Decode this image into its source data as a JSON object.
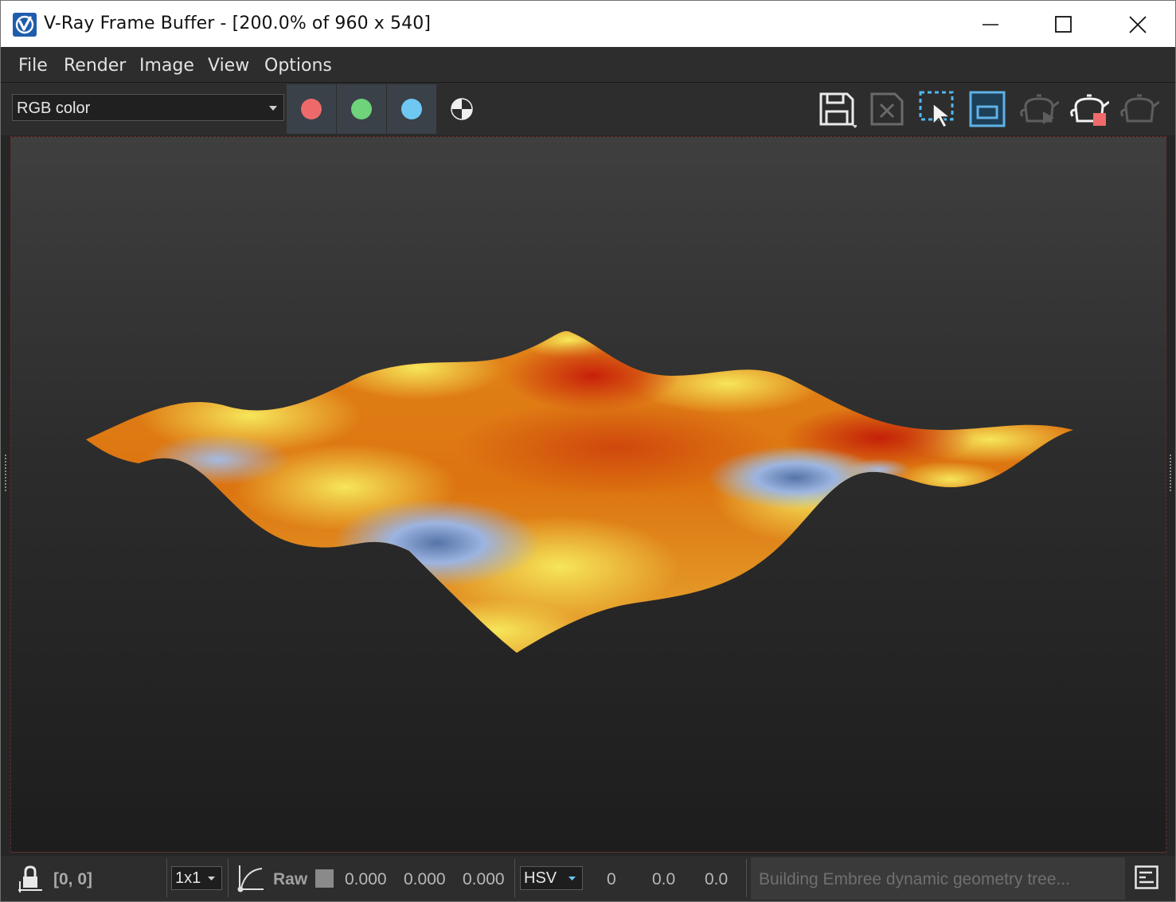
{
  "window": {
    "title": "V-Ray Frame Buffer - [200.0% of 960 x 540]",
    "controls": [
      "minimize",
      "maximize",
      "close"
    ]
  },
  "menu": {
    "items": [
      "File",
      "Render",
      "Image",
      "View",
      "Options"
    ]
  },
  "toolbar": {
    "channel_select": "RGB color",
    "channel_buttons": [
      {
        "name": "red-channel",
        "color": "#ee6a6a"
      },
      {
        "name": "green-channel",
        "color": "#6ed37a"
      },
      {
        "name": "blue-channel",
        "color": "#6ec8f2"
      }
    ],
    "alpha_icon": "alpha-channel-icon",
    "right_icons": [
      "save-image-icon",
      "clear-image-icon",
      "region-render-icon",
      "show-image-icon",
      "render-interactive-icon",
      "stop-render-icon",
      "render-icon"
    ]
  },
  "viewport": {
    "content": "rendered-wavy-surface",
    "colors": {
      "red": "#c8200a",
      "orange": "#e07810",
      "yellow": "#f2e048",
      "blue": "#94aedd"
    }
  },
  "statusbar": {
    "lock_icon": "lock-pixel-icon",
    "coords": "[0, 0]",
    "sample_size": "1x1",
    "curve_icon": "color-curve-icon",
    "raw_label": "Raw",
    "rgb_values": [
      "0.000",
      "0.000",
      "0.000"
    ],
    "color_mode": "HSV",
    "hsv_values": [
      "0",
      "0.0",
      "0.0"
    ],
    "message": "Building Embree dynamic geometry tree...",
    "log_icon": "log-panel-icon"
  }
}
